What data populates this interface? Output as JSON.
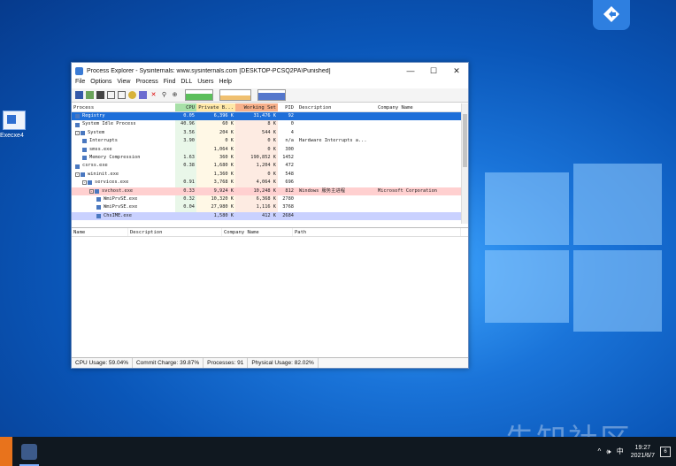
{
  "desktop": {
    "file_icon_label": "Execxe4"
  },
  "window": {
    "title": "Process Explorer - Sysinternals: www.sysinternals.com [DESKTOP-PCSQ2PA\\Punished]",
    "minimize": "—",
    "maximize": "☐",
    "close": "✕",
    "menu": [
      "File",
      "Options",
      "View",
      "Process",
      "Find",
      "DLL",
      "Users",
      "Help"
    ]
  },
  "process_table": {
    "columns": [
      "Process",
      "CPU",
      "Private B...",
      "Working Set",
      "PID",
      "Description",
      "Company Name"
    ],
    "rows": [
      {
        "name": "Registry",
        "indent": 0,
        "tree": "",
        "cpu": "0.05",
        "priv": "6,396 K",
        "ws": "31,476 K",
        "pid": "92",
        "desc": "",
        "company": "",
        "style": "sel"
      },
      {
        "name": "System Idle Process",
        "indent": 0,
        "tree": "",
        "cpu": "40.96",
        "priv": "60 K",
        "ws": "8 K",
        "pid": "0",
        "desc": "",
        "company": "",
        "style": ""
      },
      {
        "name": "System",
        "indent": 0,
        "tree": "-",
        "cpu": "3.56",
        "priv": "204 K",
        "ws": "544 K",
        "pid": "4",
        "desc": "",
        "company": "",
        "style": ""
      },
      {
        "name": "Interrupts",
        "indent": 1,
        "tree": "",
        "cpu": "3.90",
        "priv": "0 K",
        "ws": "0 K",
        "pid": "n/a",
        "desc": "Hardware Interrupts a...",
        "company": "",
        "style": ""
      },
      {
        "name": "smss.exe",
        "indent": 1,
        "tree": "",
        "cpu": "",
        "priv": "1,064 K",
        "ws": "0 K",
        "pid": "300",
        "desc": "",
        "company": "",
        "style": ""
      },
      {
        "name": "Memory Compression",
        "indent": 1,
        "tree": "",
        "cpu": "1.63",
        "priv": "360 K",
        "ws": "190,852 K",
        "pid": "1452",
        "desc": "",
        "company": "",
        "style": ""
      },
      {
        "name": "csrss.exe",
        "indent": 0,
        "tree": "",
        "cpu": "0.38",
        "priv": "1,680 K",
        "ws": "1,204 K",
        "pid": "472",
        "desc": "",
        "company": "",
        "style": ""
      },
      {
        "name": "wininit.exe",
        "indent": 0,
        "tree": "-",
        "cpu": "",
        "priv": "1,360 K",
        "ws": "0 K",
        "pid": "548",
        "desc": "",
        "company": "",
        "style": ""
      },
      {
        "name": "services.exe",
        "indent": 1,
        "tree": "-",
        "cpu": "0.91",
        "priv": "3,768 K",
        "ws": "4,064 K",
        "pid": "696",
        "desc": "",
        "company": "",
        "style": ""
      },
      {
        "name": "svchost.exe",
        "indent": 2,
        "tree": "-",
        "cpu": "0.33",
        "priv": "9,924 K",
        "ws": "10,248 K",
        "pid": "812",
        "desc": "Windows 服务主进程",
        "company": "Microsoft Corporation",
        "style": "pink"
      },
      {
        "name": "WmiPrvSE.exe",
        "indent": 3,
        "tree": "",
        "cpu": "0.32",
        "priv": "10,320 K",
        "ws": "6,368 K",
        "pid": "2780",
        "desc": "",
        "company": "",
        "style": ""
      },
      {
        "name": "WmiPrvSE.exe",
        "indent": 3,
        "tree": "",
        "cpu": "0.04",
        "priv": "27,980 K",
        "ws": "1,116 K",
        "pid": "3768",
        "desc": "",
        "company": "",
        "style": ""
      },
      {
        "name": "ChsIME.exe",
        "indent": 3,
        "tree": "",
        "cpu": "",
        "priv": "1,580 K",
        "ws": "412 K",
        "pid": "2684",
        "desc": "",
        "company": "",
        "style": "lav"
      }
    ]
  },
  "lower_pane": {
    "columns": [
      "Name",
      "Description",
      "Company Name",
      "Path"
    ]
  },
  "status": {
    "cpu": "CPU Usage: 59.04%",
    "commit": "Commit Charge: 39.87%",
    "processes": "Processes: 91",
    "physical": "Physical Usage: 82.02%"
  },
  "taskbar": {
    "tray_glyphs": "^ 🕪 中",
    "time": "19:27",
    "date": "2021/6/7",
    "notifications": "6"
  },
  "watermark": "先知社区"
}
